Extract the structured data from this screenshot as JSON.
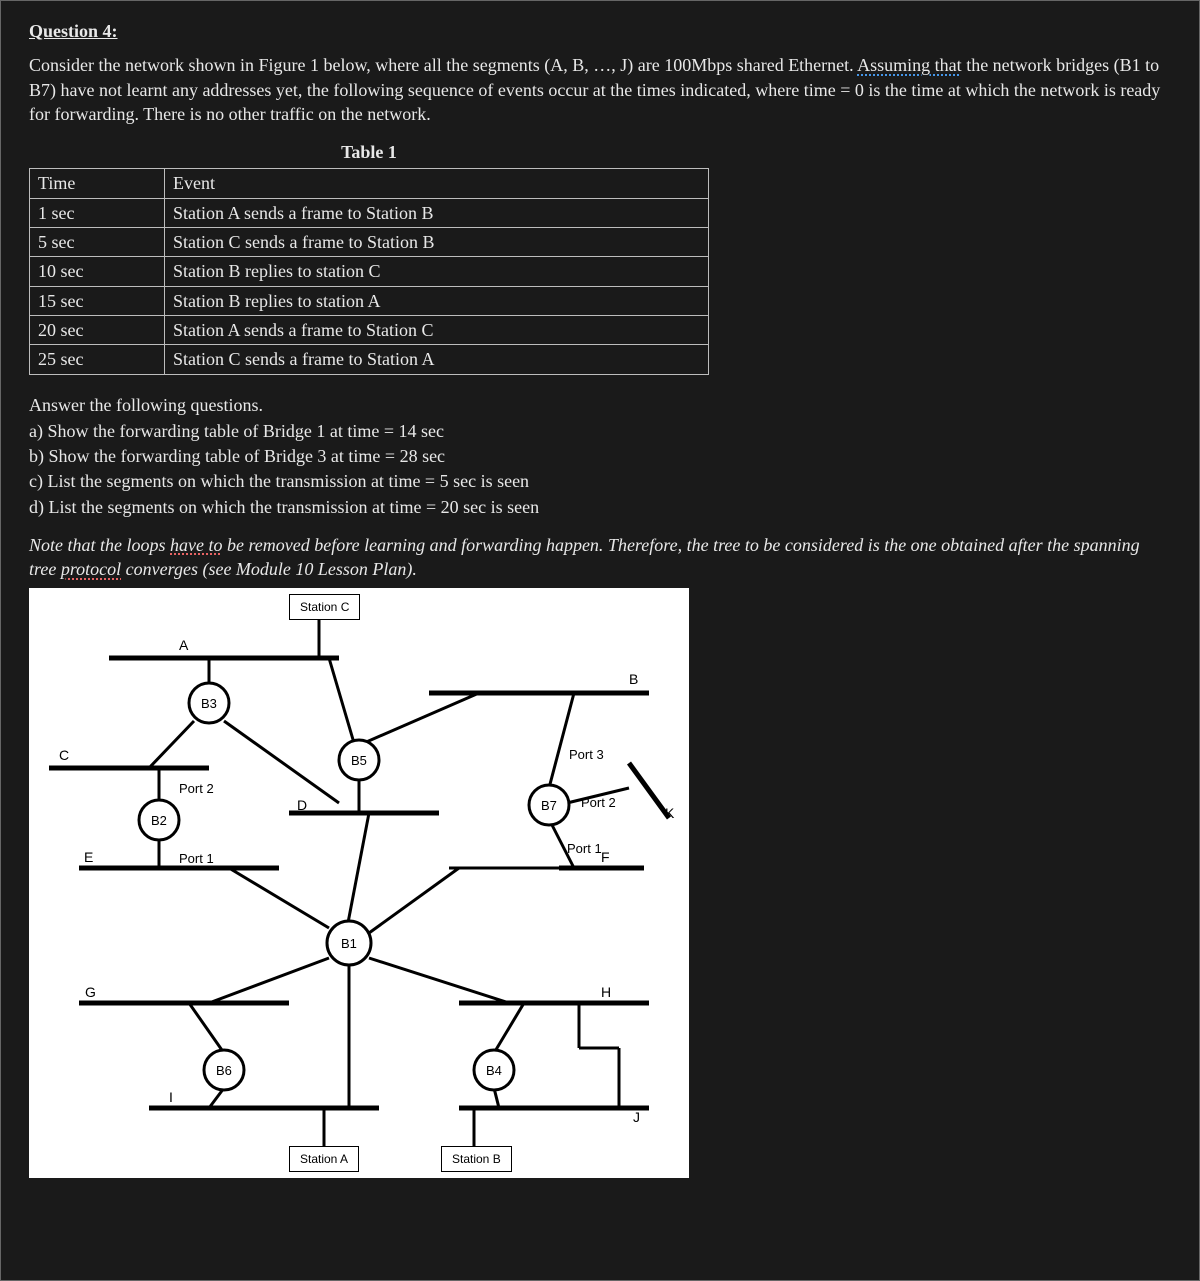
{
  "question": {
    "number": "Question 4:",
    "intro_1": "Consider the network shown in Figure 1 below, where all the segments (A, B, …, J) are 100Mbps shared Ethernet. ",
    "intro_assuming": "Assuming that",
    "intro_2": " the network bridges (B1 to B7) have not learnt any addresses yet, the following sequence of events occur at the times indicated, where time = 0 is the time at which the network is ready for forwarding. There is no other traffic on the network.",
    "table_caption": "Table 1",
    "table": {
      "headers": [
        "Time",
        "Event"
      ],
      "rows": [
        [
          "1 sec",
          "Station A sends a frame to Station B"
        ],
        [
          "5 sec",
          "Station C sends a frame to Station B"
        ],
        [
          "10 sec",
          "Station B replies to station C"
        ],
        [
          "15 sec",
          "Station B replies to station A"
        ],
        [
          "20 sec",
          "Station A sends a frame to Station C"
        ],
        [
          "25 sec",
          "Station C sends a frame to Station A"
        ]
      ]
    },
    "answer_lead": "Answer the following questions.",
    "parts": [
      "a)  Show the forwarding table of Bridge 1 at time = 14 sec",
      "b)  Show the forwarding table of Bridge 3 at time = 28 sec",
      "c)  List the segments on which the transmission at time = 5 sec is seen",
      "d)  List the segments on which the transmission at time = 20 sec is seen"
    ],
    "note_1": "Note that the loops ",
    "note_have": "have to",
    "note_2": " be removed before learning and forwarding happen. Therefore, the tree to be considered is the one obtained after the spanning tree ",
    "note_proto": "protocol",
    "note_3": " converges (see Module 10 Lesson Plan)."
  },
  "figure": {
    "station_c": "Station C",
    "station_a": "Station A",
    "station_b": "Station B",
    "bridges": {
      "b1": "B1",
      "b2": "B2",
      "b3": "B3",
      "b4": "B4",
      "b5": "B5",
      "b6": "B6",
      "b7": "B7"
    },
    "segments": {
      "A": "A",
      "B": "B",
      "C": "C",
      "D": "D",
      "E": "E",
      "F": "F",
      "G": "G",
      "H": "H",
      "I": "I",
      "J": "J",
      "K": "K"
    },
    "ports": {
      "p1": "Port 1",
      "p2": "Port 2",
      "p3": "Port 3"
    }
  }
}
